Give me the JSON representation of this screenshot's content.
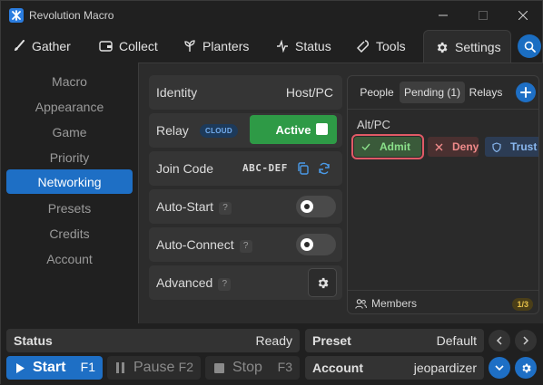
{
  "window": {
    "title": "Revolution Macro"
  },
  "tabs": [
    {
      "label": "Gather",
      "icon": "brush-icon"
    },
    {
      "label": "Collect",
      "icon": "wallet-icon"
    },
    {
      "label": "Planters",
      "icon": "sprout-icon"
    },
    {
      "label": "Status",
      "icon": "activity-icon"
    },
    {
      "label": "Tools",
      "icon": "wrench-icon"
    },
    {
      "label": "Settings",
      "icon": "gear-icon",
      "active": true
    }
  ],
  "sidebar": {
    "items": [
      {
        "label": "Macro"
      },
      {
        "label": "Appearance"
      },
      {
        "label": "Game"
      },
      {
        "label": "Priority"
      },
      {
        "label": "Networking",
        "active": true
      },
      {
        "label": "Presets"
      },
      {
        "label": "Credits"
      },
      {
        "label": "Account"
      }
    ]
  },
  "networking": {
    "identity": {
      "label": "Identity",
      "value": "Host/PC"
    },
    "relay": {
      "label": "Relay",
      "badge": "CLOUD",
      "button": "Active"
    },
    "join_code": {
      "label": "Join Code",
      "value": "ABC-DEF"
    },
    "auto_start": {
      "label": "Auto-Start",
      "help": "?",
      "enabled": false
    },
    "auto_connect": {
      "label": "Auto-Connect",
      "help": "?",
      "enabled": false
    },
    "advanced": {
      "label": "Advanced",
      "help": "?"
    }
  },
  "panel": {
    "tabs": [
      "People",
      "Pending (1)",
      "Relays"
    ],
    "active_tab": "Pending (1)",
    "entry": {
      "name": "Alt/PC",
      "actions": {
        "admit": "Admit",
        "deny": "Deny",
        "trust": "Trust"
      }
    },
    "footer": {
      "label": "Members",
      "count": "1/3"
    }
  },
  "status_bar": {
    "status": {
      "label": "Status",
      "value": "Ready"
    },
    "preset": {
      "label": "Preset",
      "value": "Default"
    },
    "account": {
      "label": "Account",
      "value": "jeopardizer"
    }
  },
  "controls": {
    "start": {
      "label": "Start",
      "key": "F1"
    },
    "pause": {
      "label": "Pause",
      "key": "F2"
    },
    "stop": {
      "label": "Stop",
      "key": "F3"
    }
  },
  "colors": {
    "accent": "#1e6fc5",
    "active_green": "#2e9a46",
    "admit": "#8ae08a",
    "deny": "#ef8a8a",
    "trust": "#8ab8ef",
    "highlight": "#e05a66"
  }
}
